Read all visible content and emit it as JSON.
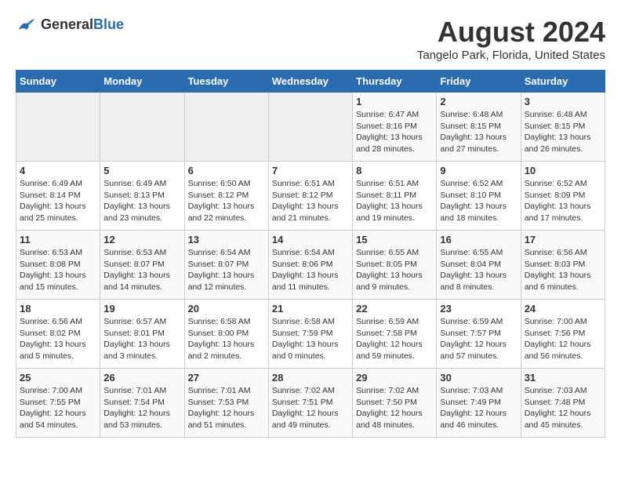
{
  "header": {
    "logo_general": "General",
    "logo_blue": "Blue",
    "month_year": "August 2024",
    "location": "Tangelo Park, Florida, United States"
  },
  "weekdays": [
    "Sunday",
    "Monday",
    "Tuesday",
    "Wednesday",
    "Thursday",
    "Friday",
    "Saturday"
  ],
  "weeks": [
    [
      {
        "day": "",
        "info": ""
      },
      {
        "day": "",
        "info": ""
      },
      {
        "day": "",
        "info": ""
      },
      {
        "day": "",
        "info": ""
      },
      {
        "day": "1",
        "info": "Sunrise: 6:47 AM\nSunset: 8:16 PM\nDaylight: 13 hours\nand 28 minutes."
      },
      {
        "day": "2",
        "info": "Sunrise: 6:48 AM\nSunset: 8:15 PM\nDaylight: 13 hours\nand 27 minutes."
      },
      {
        "day": "3",
        "info": "Sunrise: 6:48 AM\nSunset: 8:15 PM\nDaylight: 13 hours\nand 26 minutes."
      }
    ],
    [
      {
        "day": "4",
        "info": "Sunrise: 6:49 AM\nSunset: 8:14 PM\nDaylight: 13 hours\nand 25 minutes."
      },
      {
        "day": "5",
        "info": "Sunrise: 6:49 AM\nSunset: 8:13 PM\nDaylight: 13 hours\nand 23 minutes."
      },
      {
        "day": "6",
        "info": "Sunrise: 6:50 AM\nSunset: 8:12 PM\nDaylight: 13 hours\nand 22 minutes."
      },
      {
        "day": "7",
        "info": "Sunrise: 6:51 AM\nSunset: 8:12 PM\nDaylight: 13 hours\nand 21 minutes."
      },
      {
        "day": "8",
        "info": "Sunrise: 6:51 AM\nSunset: 8:11 PM\nDaylight: 13 hours\nand 19 minutes."
      },
      {
        "day": "9",
        "info": "Sunrise: 6:52 AM\nSunset: 8:10 PM\nDaylight: 13 hours\nand 18 minutes."
      },
      {
        "day": "10",
        "info": "Sunrise: 6:52 AM\nSunset: 8:09 PM\nDaylight: 13 hours\nand 17 minutes."
      }
    ],
    [
      {
        "day": "11",
        "info": "Sunrise: 6:53 AM\nSunset: 8:08 PM\nDaylight: 13 hours\nand 15 minutes."
      },
      {
        "day": "12",
        "info": "Sunrise: 6:53 AM\nSunset: 8:07 PM\nDaylight: 13 hours\nand 14 minutes."
      },
      {
        "day": "13",
        "info": "Sunrise: 6:54 AM\nSunset: 8:07 PM\nDaylight: 13 hours\nand 12 minutes."
      },
      {
        "day": "14",
        "info": "Sunrise: 6:54 AM\nSunset: 8:06 PM\nDaylight: 13 hours\nand 11 minutes."
      },
      {
        "day": "15",
        "info": "Sunrise: 6:55 AM\nSunset: 8:05 PM\nDaylight: 13 hours\nand 9 minutes."
      },
      {
        "day": "16",
        "info": "Sunrise: 6:55 AM\nSunset: 8:04 PM\nDaylight: 13 hours\nand 8 minutes."
      },
      {
        "day": "17",
        "info": "Sunrise: 6:56 AM\nSunset: 8:03 PM\nDaylight: 13 hours\nand 6 minutes."
      }
    ],
    [
      {
        "day": "18",
        "info": "Sunrise: 6:56 AM\nSunset: 8:02 PM\nDaylight: 13 hours\nand 5 minutes."
      },
      {
        "day": "19",
        "info": "Sunrise: 6:57 AM\nSunset: 8:01 PM\nDaylight: 13 hours\nand 3 minutes."
      },
      {
        "day": "20",
        "info": "Sunrise: 6:58 AM\nSunset: 8:00 PM\nDaylight: 13 hours\nand 2 minutes."
      },
      {
        "day": "21",
        "info": "Sunrise: 6:58 AM\nSunset: 7:59 PM\nDaylight: 13 hours\nand 0 minutes."
      },
      {
        "day": "22",
        "info": "Sunrise: 6:59 AM\nSunset: 7:58 PM\nDaylight: 12 hours\nand 59 minutes."
      },
      {
        "day": "23",
        "info": "Sunrise: 6:59 AM\nSunset: 7:57 PM\nDaylight: 12 hours\nand 57 minutes."
      },
      {
        "day": "24",
        "info": "Sunrise: 7:00 AM\nSunset: 7:56 PM\nDaylight: 12 hours\nand 56 minutes."
      }
    ],
    [
      {
        "day": "25",
        "info": "Sunrise: 7:00 AM\nSunset: 7:55 PM\nDaylight: 12 hours\nand 54 minutes."
      },
      {
        "day": "26",
        "info": "Sunrise: 7:01 AM\nSunset: 7:54 PM\nDaylight: 12 hours\nand 53 minutes."
      },
      {
        "day": "27",
        "info": "Sunrise: 7:01 AM\nSunset: 7:53 PM\nDaylight: 12 hours\nand 51 minutes."
      },
      {
        "day": "28",
        "info": "Sunrise: 7:02 AM\nSunset: 7:51 PM\nDaylight: 12 hours\nand 49 minutes."
      },
      {
        "day": "29",
        "info": "Sunrise: 7:02 AM\nSunset: 7:50 PM\nDaylight: 12 hours\nand 48 minutes."
      },
      {
        "day": "30",
        "info": "Sunrise: 7:03 AM\nSunset: 7:49 PM\nDaylight: 12 hours\nand 46 minutes."
      },
      {
        "day": "31",
        "info": "Sunrise: 7:03 AM\nSunset: 7:48 PM\nDaylight: 12 hours\nand 45 minutes."
      }
    ]
  ]
}
